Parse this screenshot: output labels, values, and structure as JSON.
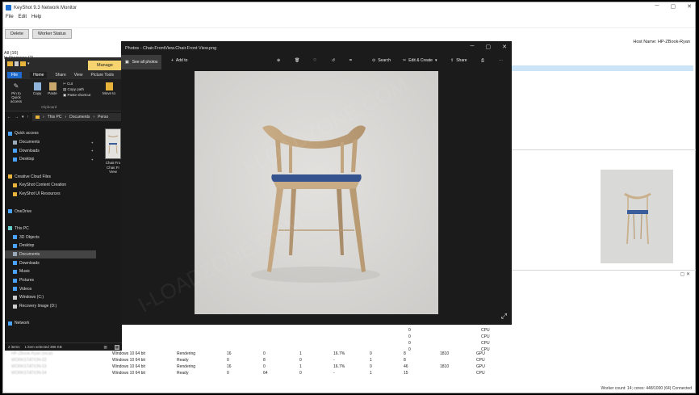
{
  "keyshot": {
    "title": "KeyShot 9.3 Network Monitor",
    "menu": [
      "File",
      "Edit",
      "Help"
    ],
    "toolbar": {
      "delete": "Delete",
      "worker_status": "Worker Status"
    },
    "host": "Host Name: HP-ZBook-Ryan",
    "left_panel": {
      "all": "All (16)",
      "in_progress": "In Progress (2)"
    },
    "rows": [
      {
        "name": "HP-ZBook-Ryan (local)",
        "os": "Windows 10 64 bit",
        "status": "Rendering",
        "c1": "16",
        "c2": "0",
        "c3": "1",
        "pct": "16.7%",
        "c4": "0",
        "c5": "8",
        "c6": "1810",
        "dev": "GPU"
      },
      {
        "name": "WORKSTATION-02",
        "os": "Windows 10 64 bit",
        "status": "Ready",
        "c1": "0",
        "c2": "8",
        "c3": "0",
        "pct": "-",
        "c4": "1",
        "c5": "8",
        "c6": "",
        "dev": "CPU"
      },
      {
        "name": "WORKSTATION-03",
        "os": "Windows 10 64 bit",
        "status": "Rendering",
        "c1": "16",
        "c2": "0",
        "c3": "1",
        "pct": "16.7%",
        "c4": "0",
        "c5": "46",
        "c6": "1810",
        "dev": "GPU"
      },
      {
        "name": "WORKSTATION-04",
        "os": "Windows 10 64 bit",
        "status": "Ready",
        "c1": "0",
        "c2": "64",
        "c3": "0",
        "pct": "-",
        "c4": "1",
        "c5": "15",
        "c6": "",
        "dev": "CPU"
      }
    ],
    "upper_rows": [
      {
        "c5": "0",
        "dev": "CPU"
      },
      {
        "c5": "0",
        "dev": "CPU"
      },
      {
        "c5": "0",
        "dev": "CPU"
      },
      {
        "c5": "0",
        "dev": "CPU"
      },
      {
        "c5": "0",
        "dev": "CPU"
      }
    ],
    "statusbar": "Worker count: 14; cores: 448/1000 (64) Connected"
  },
  "explorer": {
    "manage": "Manage",
    "tabs": [
      "File",
      "Home",
      "Share",
      "View",
      "Picture Tools"
    ],
    "ribbon": {
      "pin": "Pin to Quick access",
      "copy": "Copy",
      "paste": "Paste",
      "cut": "Cut",
      "copy_path": "Copy path",
      "paste_shortcut": "Paste shortcut",
      "move_to": "Move to",
      "clipboard": "Clipboard"
    },
    "breadcrumb": [
      "This PC",
      "Documents",
      "Perso"
    ],
    "nav": [
      {
        "label": "Quick access",
        "color": "#4aa3ff",
        "indent": 0,
        "pin": false
      },
      {
        "label": "Documents",
        "color": "#9ab",
        "indent": 1,
        "pin": true
      },
      {
        "label": "Downloads",
        "color": "#4aa3ff",
        "indent": 1,
        "pin": true
      },
      {
        "label": "Desktop",
        "color": "#4aa3ff",
        "indent": 1,
        "pin": true
      },
      {
        "label": "",
        "color": "",
        "indent": 0,
        "pin": false
      },
      {
        "label": "Creative Cloud Files",
        "color": "#e8b33b",
        "indent": 0,
        "pin": false
      },
      {
        "label": "KeyShot Content Creation",
        "color": "#e8b33b",
        "indent": 1,
        "pin": false
      },
      {
        "label": "KeyShot UI Resources",
        "color": "#e8b33b",
        "indent": 1,
        "pin": false
      },
      {
        "label": "",
        "color": "",
        "indent": 0,
        "pin": false
      },
      {
        "label": "OneDrive",
        "color": "#4aa3ff",
        "indent": 0,
        "pin": false
      },
      {
        "label": "",
        "color": "",
        "indent": 0,
        "pin": false
      },
      {
        "label": "This PC",
        "color": "#6cc",
        "indent": 0,
        "pin": false
      },
      {
        "label": "3D Objects",
        "color": "#4aa3ff",
        "indent": 1,
        "pin": false
      },
      {
        "label": "Desktop",
        "color": "#4aa3ff",
        "indent": 1,
        "pin": false
      },
      {
        "label": "Documents",
        "color": "#9ab",
        "indent": 1,
        "pin": false,
        "selected": true
      },
      {
        "label": "Downloads",
        "color": "#4aa3ff",
        "indent": 1,
        "pin": false
      },
      {
        "label": "Music",
        "color": "#4aa3ff",
        "indent": 1,
        "pin": false
      },
      {
        "label": "Pictures",
        "color": "#4aa3ff",
        "indent": 1,
        "pin": false
      },
      {
        "label": "Videos",
        "color": "#4aa3ff",
        "indent": 1,
        "pin": false
      },
      {
        "label": "Windows (C:)",
        "color": "#ccc",
        "indent": 1,
        "pin": false
      },
      {
        "label": "Recovery Image (D:)",
        "color": "#ccc",
        "indent": 1,
        "pin": false
      },
      {
        "label": "",
        "color": "",
        "indent": 0,
        "pin": false
      },
      {
        "label": "Network",
        "color": "#4aa3ff",
        "indent": 0,
        "pin": false
      }
    ],
    "file": {
      "line1": "Chair.Fro",
      "line2": "Chair.Fr",
      "line3": "View"
    },
    "status": {
      "items": "2 items",
      "selected": "1 item selected  396 KB"
    }
  },
  "photos": {
    "title": "Photos - Chair.FrontView.Chair.Front View.png",
    "see_all": "See all photos",
    "add_to": "Add to",
    "search": "Search",
    "edit_create": "Edit & Create",
    "share": "Share",
    "watermark": "I-LOADZONE.COM"
  }
}
